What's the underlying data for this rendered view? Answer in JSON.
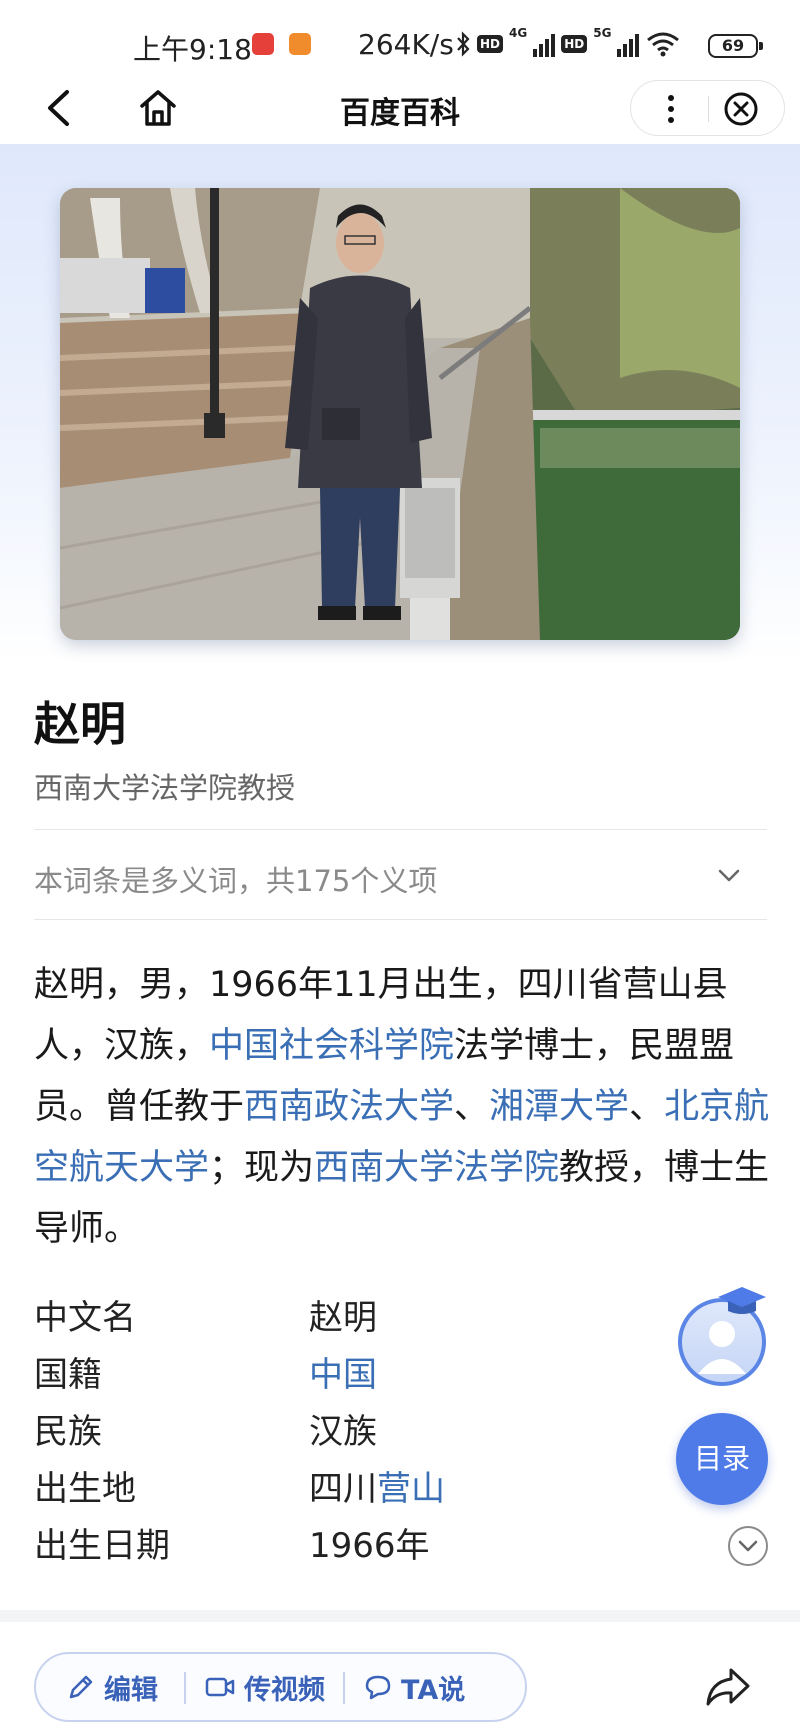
{
  "status": {
    "time": "上午9:18",
    "net_speed": "264K/s",
    "hd_label": "HD",
    "net_4g": "4G",
    "net_5g": "5G",
    "battery": "69"
  },
  "nav": {
    "title": "百度百科"
  },
  "entry": {
    "name": "赵明",
    "subtitle": "西南大学法学院教授",
    "polysemy_note": "本词条是多义词，共175个义项",
    "summary": {
      "p1": "赵明，男，1966年11月出生，四川省营山县人，汉族，",
      "l1": "中国社会科学院",
      "p2": "法学博士，民盟盟员。曾任教于",
      "l2": "西南政法大学",
      "p3": "、",
      "l3": "湘潭大学",
      "p4": "、",
      "l4": "北京航空航天大学",
      "p5": "；现为",
      "l5": "西南大学法学院",
      "p6": "教授，博士生导师。"
    }
  },
  "infobox": [
    {
      "label": "中文名",
      "value": "赵明"
    },
    {
      "label": "国籍",
      "value_link": "中国"
    },
    {
      "label": "民族",
      "value": "汉族"
    },
    {
      "label": "出生地",
      "value": "四川",
      "value_link": "营山"
    },
    {
      "label": "出生日期",
      "value": "1966年"
    }
  ],
  "floating": {
    "toc_label": "目录"
  },
  "bottom_bar": {
    "edit_label": "编辑",
    "video_label": "传视频",
    "ta_label": "TA说"
  },
  "colors": {
    "link": "#3a6fb5",
    "accent": "#4e7be8"
  }
}
